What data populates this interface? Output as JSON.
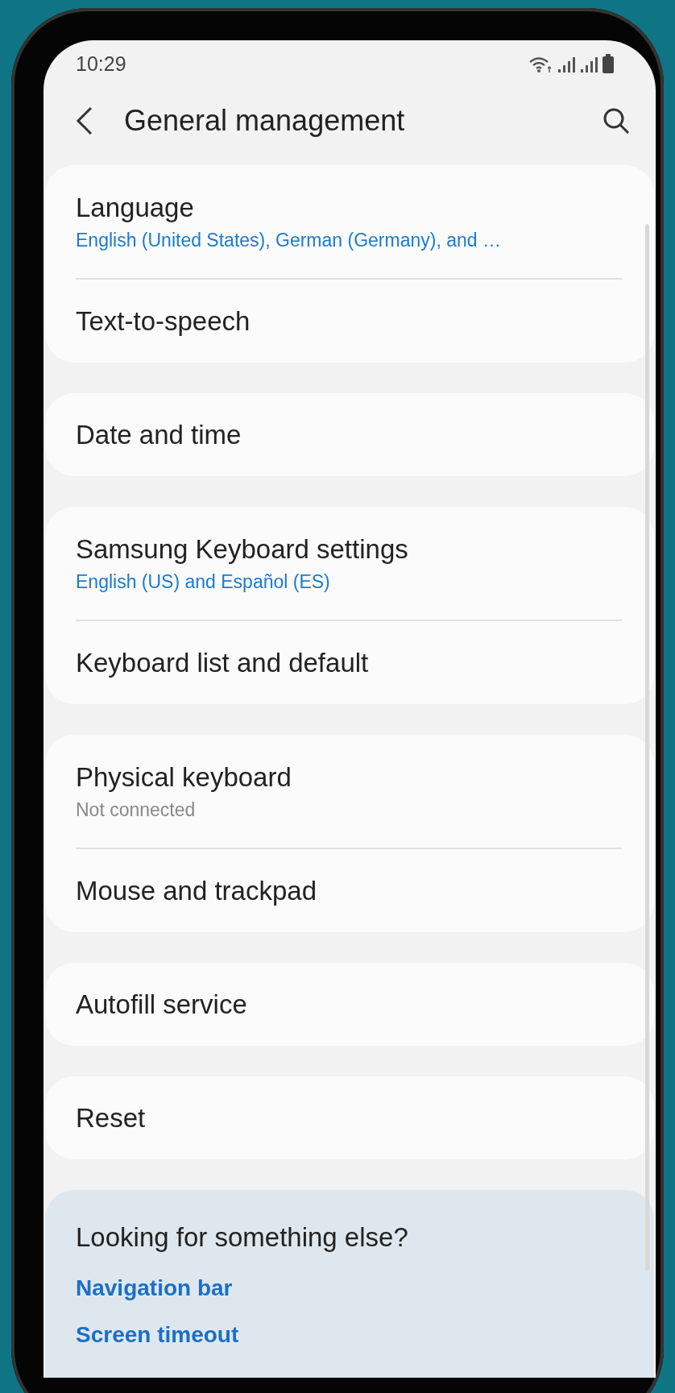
{
  "status_bar": {
    "time": "10:29"
  },
  "header": {
    "title": "General management"
  },
  "groups": [
    {
      "items": [
        {
          "title": "Language",
          "subtitle": "English (United States), German (Germany), and …",
          "kind": "accent"
        },
        {
          "title": "Text-to-speech"
        }
      ]
    },
    {
      "items": [
        {
          "title": "Date and time"
        }
      ]
    },
    {
      "items": [
        {
          "title": "Samsung Keyboard settings",
          "subtitle": "English (US) and Español (ES)",
          "kind": "accent"
        },
        {
          "title": "Keyboard list and default"
        }
      ]
    },
    {
      "items": [
        {
          "title": "Physical keyboard",
          "subtitle": "Not connected",
          "kind": "muted"
        },
        {
          "title": "Mouse and trackpad"
        }
      ]
    },
    {
      "items": [
        {
          "title": "Autofill service"
        }
      ]
    },
    {
      "items": [
        {
          "title": "Reset"
        }
      ]
    }
  ],
  "suggestions": {
    "heading": "Looking for something else?",
    "links": [
      "Navigation bar",
      "Screen timeout"
    ]
  }
}
